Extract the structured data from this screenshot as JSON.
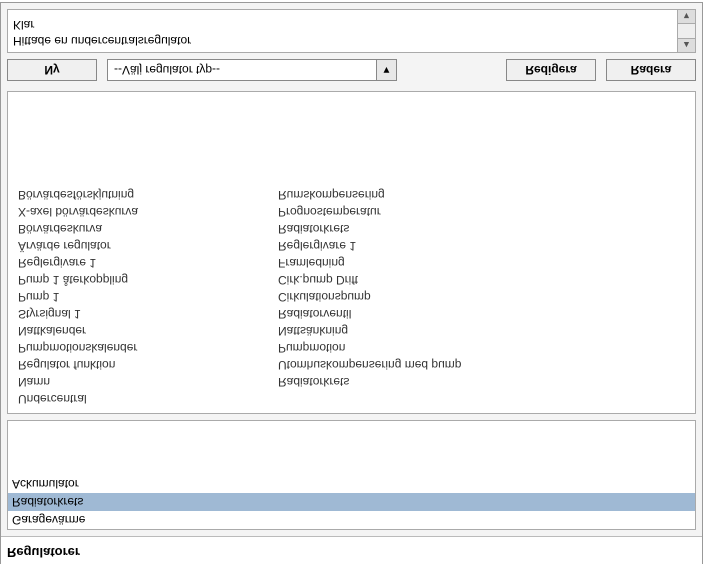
{
  "title": "Regulatorer",
  "list": {
    "items": [
      {
        "label": "Garagevärme",
        "selected": false
      },
      {
        "label": "Radiatorkrets",
        "selected": true
      },
      {
        "label": "Ackumulator",
        "selected": false
      }
    ]
  },
  "detail": {
    "header": "Undercentral",
    "rows": [
      {
        "label": "Namn",
        "value": "Radiatorkrets"
      },
      {
        "label": "Regulator funktion",
        "value": "Utomhuskompensering med pump"
      },
      {
        "label": "Pumpmotionskalender",
        "value": "Pumpmotion"
      },
      {
        "label": "Nattkalender",
        "value": "Nattsänkning"
      },
      {
        "label": "Styrsignal 1",
        "value": "Radiatorventil"
      },
      {
        "label": "Pump 1",
        "value": "Cirkulationspump"
      },
      {
        "label": "Pump 1 återkoppling",
        "value": "Cirk.pump Drift"
      },
      {
        "label": "Reglergivare 1",
        "value": "Framledning"
      },
      {
        "label": "Ärvärde regulator",
        "value": "Reglergivare 1"
      },
      {
        "label": "Börvärdeskurva",
        "value": "Radiatorkrets"
      },
      {
        "label": "X-axel börvärdeskurva",
        "value": "Prognostemperatur"
      },
      {
        "label": "Börvärdesförskjutning",
        "value": "Rumskompensering"
      }
    ]
  },
  "toolbar": {
    "new_label": "Ny",
    "type_select": "--Välj regulator typ--",
    "edit_label": "Redigera",
    "delete_label": "Radera"
  },
  "status": {
    "line1": "Hittade en undercentralsregulator",
    "line2": "Klar"
  }
}
